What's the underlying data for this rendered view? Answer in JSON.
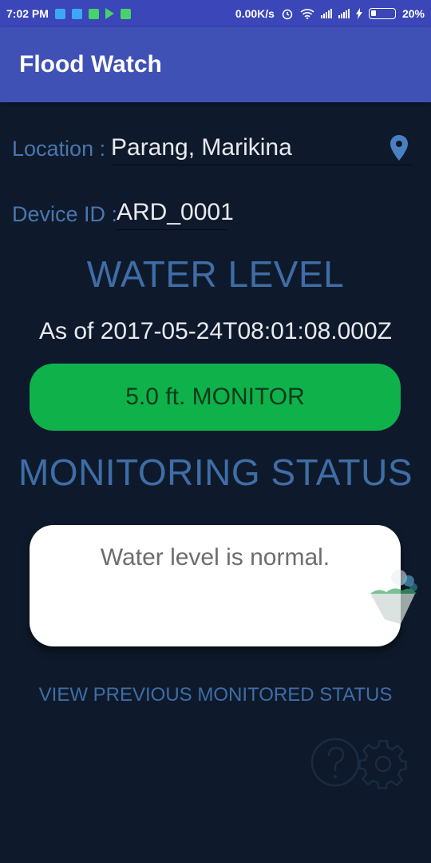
{
  "status_bar": {
    "time": "7:02 PM",
    "net_speed": "0.00K/s",
    "battery": "20%",
    "icons": [
      "usb-icon",
      "notification-icon",
      "android-icon",
      "play-store-icon",
      "android-icon",
      "alarm-icon",
      "wifi-icon",
      "signal-icon",
      "signal-icon",
      "charging-icon",
      "battery-icon"
    ]
  },
  "app_bar": {
    "title": "Flood Watch"
  },
  "location": {
    "label": "Location :",
    "value": "Parang, Marikina",
    "icon": "location-pin-icon"
  },
  "device": {
    "label": "Device ID :",
    "value": "ARD_0001"
  },
  "water_level": {
    "heading": "WATER LEVEL",
    "as_of": "As of 2017-05-24T08:01:08.000Z",
    "reading": "5.0 ft. MONITOR",
    "reading_color": "#0fb14b"
  },
  "monitoring": {
    "heading": "MONITORING STATUS",
    "message": "Water level is normal."
  },
  "actions": {
    "view_previous": "VIEW PREVIOUS MONITORED STATUS",
    "help_icon": "help-icon",
    "settings_icon": "gear-icon"
  },
  "colors": {
    "background": "#0e1a2b",
    "app_bar": "#3f51b5",
    "accent": "#3f6da6"
  }
}
